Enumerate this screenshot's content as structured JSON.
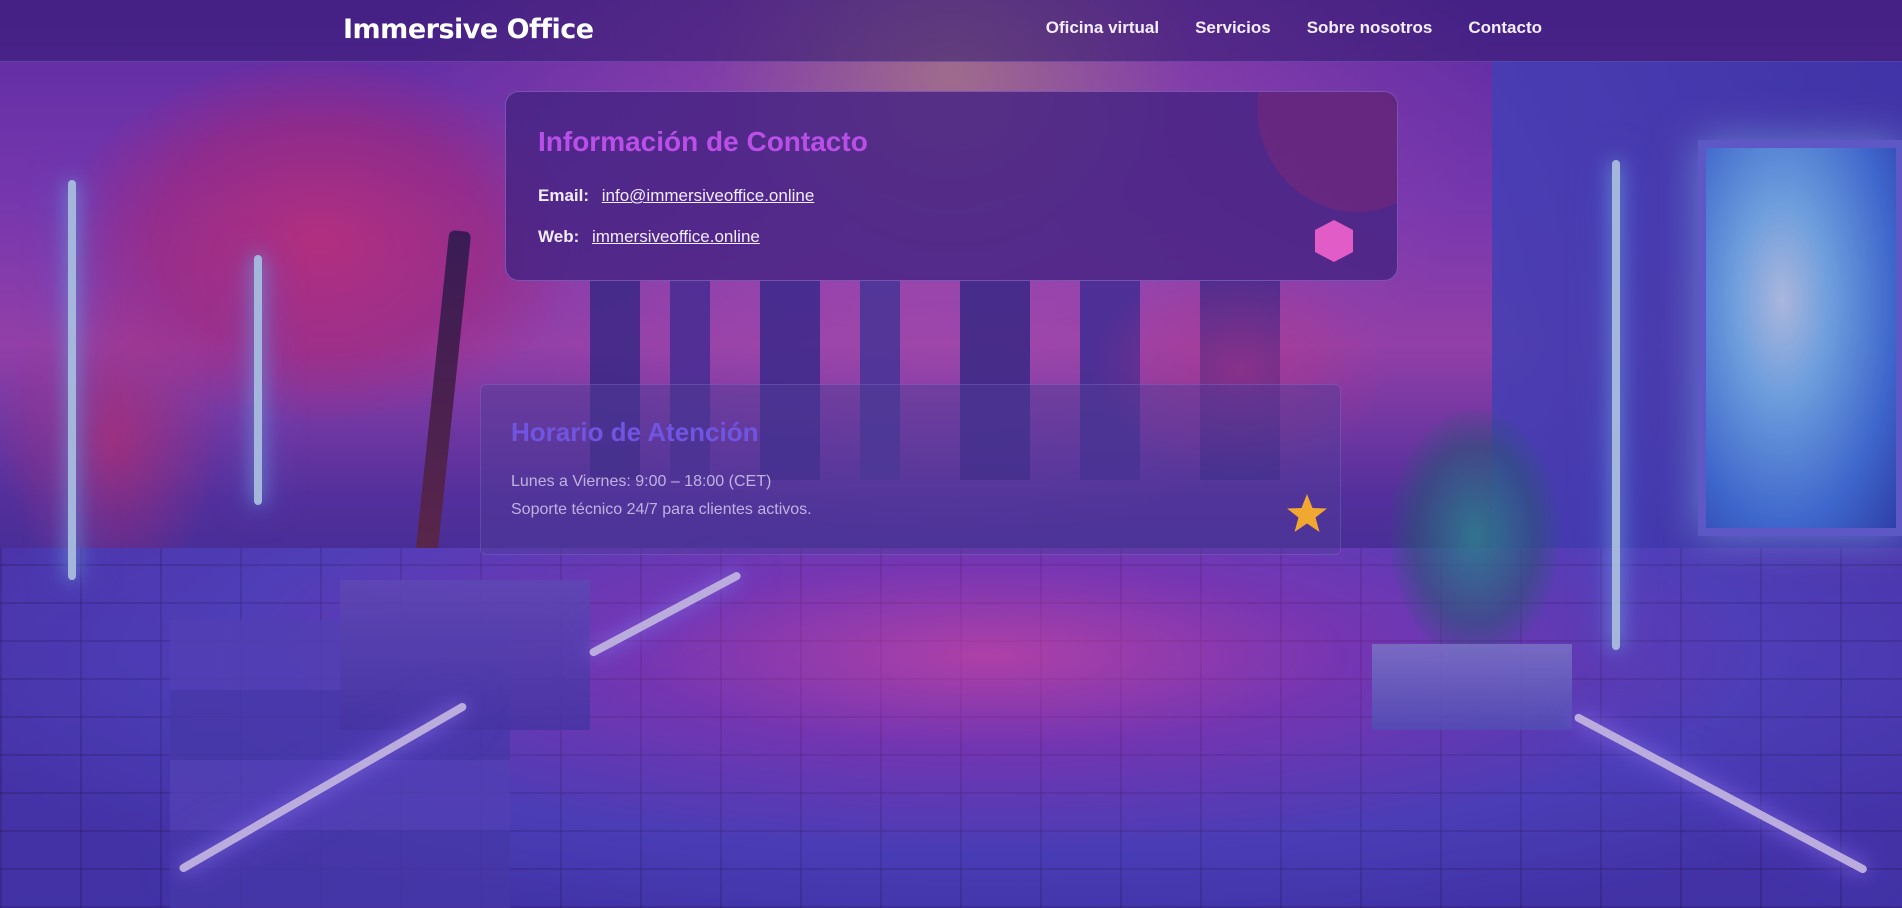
{
  "header": {
    "brand": "Immersive Office",
    "nav": [
      {
        "label": "Oficina virtual"
      },
      {
        "label": "Servicios"
      },
      {
        "label": "Sobre nosotros"
      },
      {
        "label": "Contacto"
      }
    ]
  },
  "contact": {
    "title": "Información de Contacto",
    "email_label": "Email:",
    "email_value": "info@immersiveoffice.online",
    "web_label": "Web:",
    "web_value": "immersiveoffice.online"
  },
  "hours": {
    "title": "Horario de Atención",
    "line1": "Lunes a Viernes: 9:00 – 18:00 (CET)",
    "line2": "Soporte técnico 24/7 para clientes activos."
  },
  "colors": {
    "accent_title": "#b94fe6",
    "hours_title": "#6f55e0",
    "hexagon": "#e25cc8",
    "star": "#f0a830"
  },
  "icons": {
    "contact_decor": "hexagon-icon",
    "hours_decor": "star-icon"
  }
}
